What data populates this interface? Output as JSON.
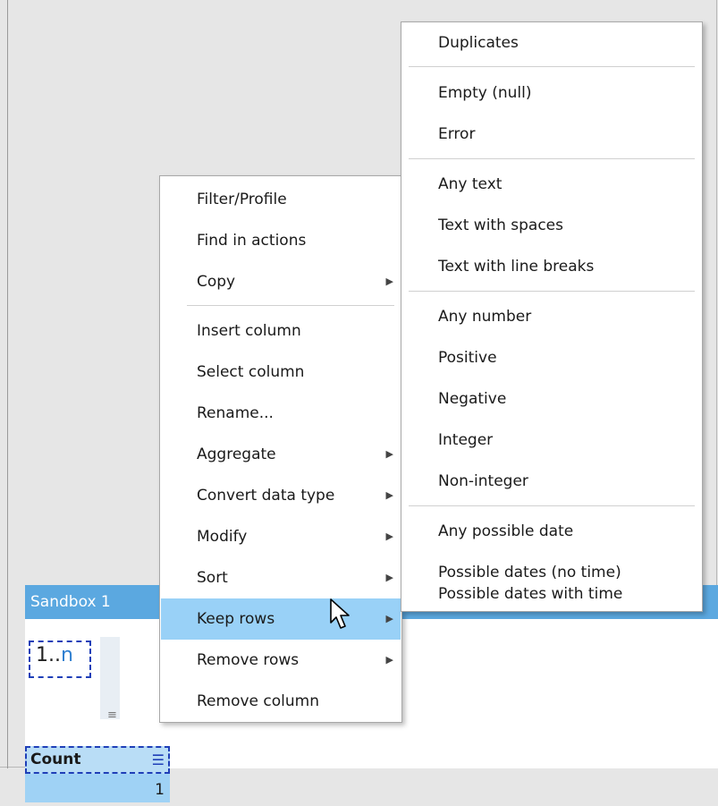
{
  "sandbox": {
    "title": "Sandbox 1",
    "type_chip": {
      "prefix": "1..",
      "suffix": "n"
    },
    "column_header": "Count",
    "first_cell_value": "1"
  },
  "context_menu": {
    "items": [
      {
        "label": "Filter/Profile",
        "has_submenu": false
      },
      {
        "label": "Find in actions",
        "has_submenu": false
      },
      {
        "label": "Copy",
        "has_submenu": true
      },
      {
        "label": "Insert  column",
        "has_submenu": false
      },
      {
        "label": "Select  column",
        "has_submenu": false
      },
      {
        "label": "Rename...",
        "has_submenu": false
      },
      {
        "label": "Aggregate",
        "has_submenu": true
      },
      {
        "label": "Convert data type",
        "has_submenu": true
      },
      {
        "label": "Modify",
        "has_submenu": true
      },
      {
        "label": "Sort",
        "has_submenu": true
      },
      {
        "label": "Keep rows",
        "has_submenu": true,
        "highlighted": true
      },
      {
        "label": "Remove rows",
        "has_submenu": true
      },
      {
        "label": "Remove  column",
        "has_submenu": false
      }
    ]
  },
  "keep_rows_submenu": {
    "items": [
      "Duplicates",
      "Empty (null)",
      "Error",
      "Any text",
      "Text with spaces",
      "Text with line breaks",
      "Any number",
      "Positive",
      "Negative",
      "Integer",
      "Non-integer",
      "Any possible date",
      "Possible dates (no time)",
      "Possible dates with time"
    ]
  },
  "colors": {
    "highlight": "#99d1f7",
    "sandbox_title_bar": "#5ba8e0",
    "selection_border": "#1f3fb8"
  },
  "icons": {
    "submenu_arrow": "chevron-right-icon",
    "cursor": "mouse-pointer-icon",
    "sort": "sort-icon"
  }
}
